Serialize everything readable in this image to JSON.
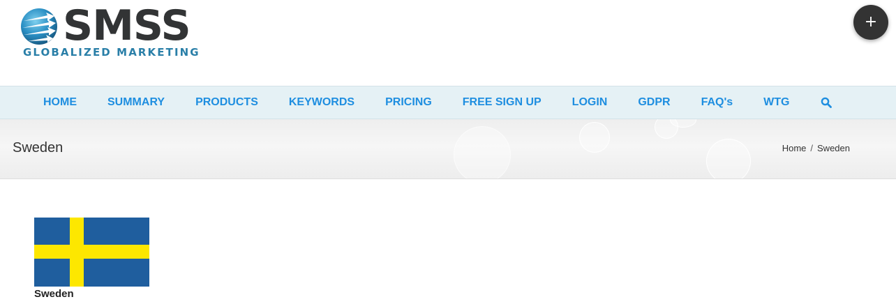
{
  "brand": {
    "name": "SMSS",
    "tagline": "GLOBALIZED MARKETING",
    "colors": {
      "dark": "#323435",
      "accent": "#2a7fa8"
    }
  },
  "fab": {
    "label": "+",
    "color": "#333333"
  },
  "nav": {
    "color": "#1e8ee0",
    "items": [
      {
        "label": "HOME"
      },
      {
        "label": "SUMMARY"
      },
      {
        "label": "PRODUCTS"
      },
      {
        "label": "KEYWORDS"
      },
      {
        "label": "PRICING"
      },
      {
        "label": "FREE SIGN UP"
      },
      {
        "label": "LOGIN"
      },
      {
        "label": "GDPR"
      },
      {
        "label": "FAQ's"
      },
      {
        "label": "WTG"
      }
    ],
    "search_icon": "search-icon"
  },
  "page": {
    "title": "Sweden",
    "breadcrumb": {
      "home": "Home",
      "separator": "/",
      "current": "Sweden"
    }
  },
  "content": {
    "flag": {
      "icon": "sweden-flag",
      "blue": "#1f5e9e",
      "yellow": "#fde700"
    },
    "caption": "Sweden"
  }
}
